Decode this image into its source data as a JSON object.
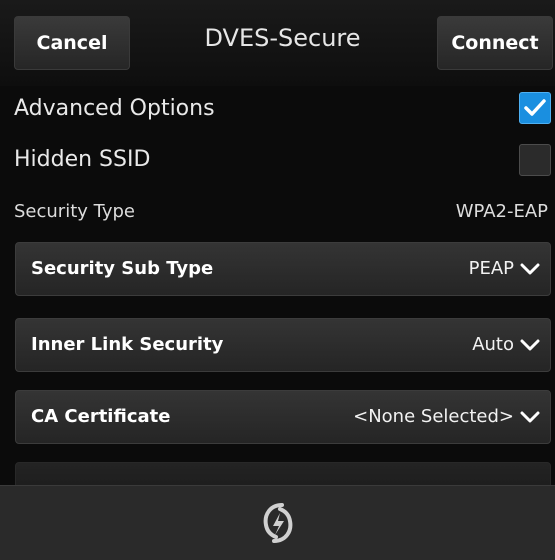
{
  "header": {
    "cancel_label": "Cancel",
    "title": "DVES-Secure",
    "connect_label": "Connect"
  },
  "options": {
    "advanced_label": "Advanced Options",
    "advanced_checked": true,
    "hidden_ssid_label": "Hidden SSID",
    "hidden_ssid_checked": false
  },
  "security_type": {
    "label": "Security Type",
    "value": "WPA2-EAP"
  },
  "dropdowns": [
    {
      "label": "Security Sub Type",
      "value": "PEAP"
    },
    {
      "label": "Inner Link Security",
      "value": "Auto"
    },
    {
      "label": "CA Certificate",
      "value": "<None Selected>"
    }
  ],
  "bottom_bar": {
    "icon": "refresh-swirl-icon"
  },
  "colors": {
    "accent": "#1a8fe0",
    "background": "#0b0b0b",
    "bottom_bar": "#2a2a2a"
  }
}
